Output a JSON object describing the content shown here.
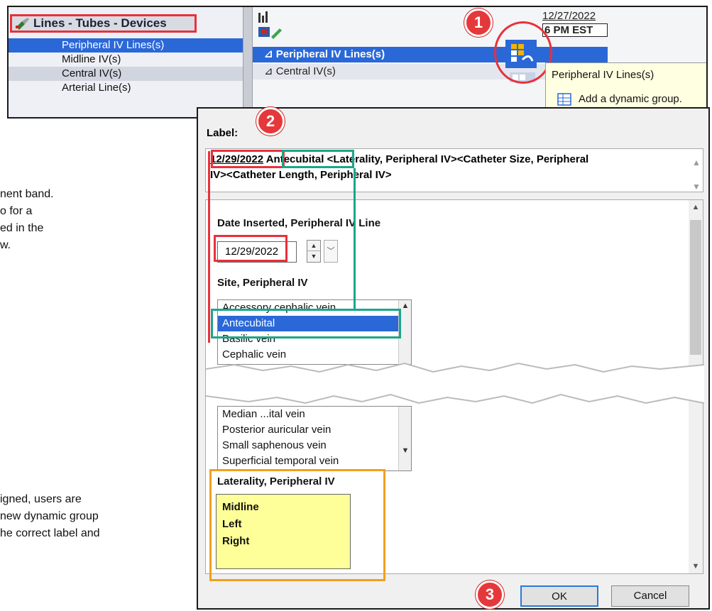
{
  "tree": {
    "header": "Lines - Tubes - Devices",
    "items": [
      "Peripheral IV Lines(s)",
      "Midline IV(s)",
      "Central IV(s)",
      "Arterial Line(s)"
    ]
  },
  "grid": {
    "bands": [
      "⊿ Peripheral IV Lines(s)",
      "⊿ Central IV(s)"
    ],
    "date": "12/27/2022",
    "time": "6 PM EST"
  },
  "tooltip": {
    "title": "Peripheral IV Lines(s)",
    "action": "Add a dynamic group."
  },
  "badges": [
    "1",
    "2",
    "3"
  ],
  "side_text": {
    "lines_top": [
      "nent band.",
      "o for a",
      "ed in the",
      "w."
    ],
    "lines_bottom": [
      "igned, users are",
      "new dynamic group",
      "he correct label and"
    ]
  },
  "dialog": {
    "label_title": "Label:",
    "label_date": "12/29/2022",
    "label_rest_bold": "Antecubital",
    "label_line1_tail": "<Laterality, Peripheral IV><Catheter Size, Peripheral",
    "label_line2": "IV><Catheter Length, Peripheral IV>",
    "date_field_title": "Date Inserted, Peripheral IV Line",
    "date_value": "12/29/2022",
    "site_title": "Site, Peripheral IV",
    "site_options_top": [
      "Accessory cephalic vein",
      "Antecubital",
      "Basilic vein",
      "Cephalic vein"
    ],
    "site_selected": "Antecubital",
    "site_options_bottom": [
      "Median ...ital vein",
      "Posterior auricular vein",
      "Small saphenous vein",
      "Superficial temporal vein"
    ],
    "laterality_title": "Laterality, Peripheral IV",
    "laterality_options": [
      "Midline",
      "Left",
      "Right"
    ],
    "ok_label": "OK",
    "cancel_label": "Cancel"
  },
  "colors": {
    "selection_blue": "#2a68d8",
    "badge_red": "#e5383b",
    "annotation_red": "#e8313b",
    "annotation_green": "#1aa68a",
    "annotation_orange": "#f0a020",
    "laterality_yellow": "#ffff99"
  }
}
